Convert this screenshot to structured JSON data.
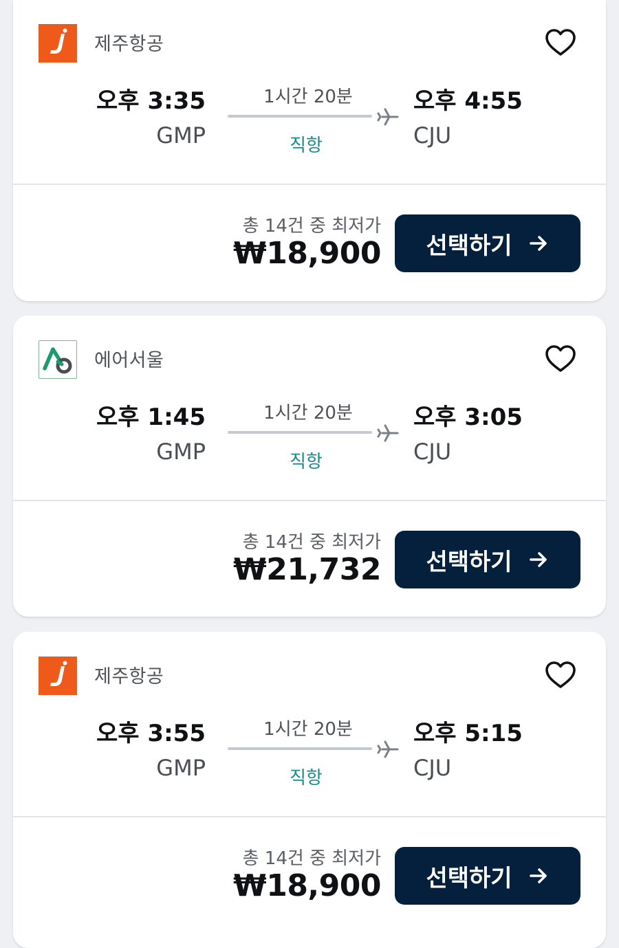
{
  "flights": [
    {
      "airline_name": "제주항공",
      "airline_logo": "jeju-air-logo",
      "departure_time": "오후 3:35",
      "departure_code": "GMP",
      "duration": "1시간 20분",
      "stops": "직항",
      "arrival_time": "오후 4:55",
      "arrival_code": "CJU",
      "price_note": "총 14건 중 최저가",
      "price": "₩18,900",
      "select_label": "선택하기"
    },
    {
      "airline_name": "에어서울",
      "airline_logo": "air-seoul-logo",
      "departure_time": "오후 1:45",
      "departure_code": "GMP",
      "duration": "1시간 20분",
      "stops": "직항",
      "arrival_time": "오후 3:05",
      "arrival_code": "CJU",
      "price_note": "총 14건 중 최저가",
      "price": "₩21,732",
      "select_label": "선택하기"
    },
    {
      "airline_name": "제주항공",
      "airline_logo": "jeju-air-logo",
      "departure_time": "오후 3:55",
      "departure_code": "GMP",
      "duration": "1시간 20분",
      "stops": "직항",
      "arrival_time": "오후 5:15",
      "arrival_code": "CJU",
      "price_note": "총 14건 중 최저가",
      "price": "₩18,900",
      "select_label": "선택하기"
    }
  ],
  "icons": {
    "favorite": "heart-outline-icon",
    "route": "airplane-icon",
    "select": "arrow-right-icon"
  },
  "colors": {
    "page_background": "#eef0f3",
    "card_background": "#ffffff",
    "button_background": "#05203c",
    "button_text": "#ffffff",
    "direct_flight_text": "#1a8a8a",
    "jeju_air_brand": "#ef5a1a",
    "air_seoul_brand": "#1f9a6e"
  }
}
